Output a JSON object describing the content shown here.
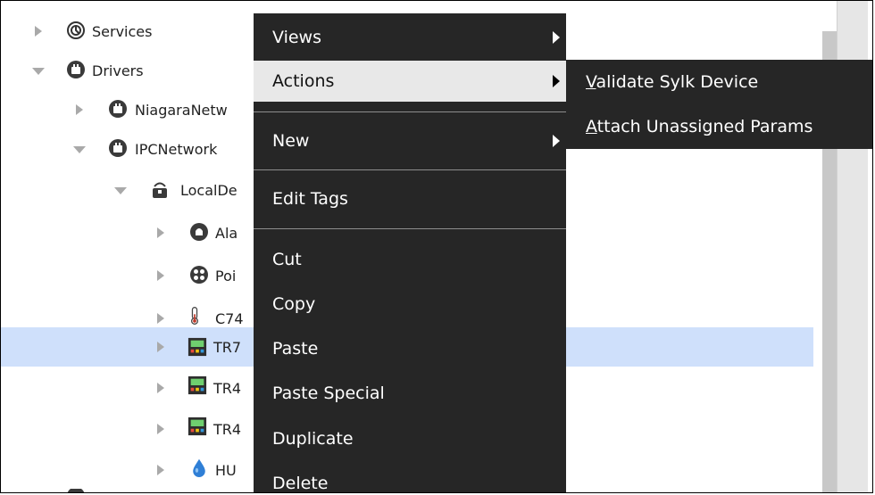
{
  "tree": {
    "items": [
      {
        "label": "Services",
        "icon": "services-gear-icon",
        "expanded": false
      },
      {
        "label": "Drivers",
        "icon": "drivers-icon",
        "expanded": true
      },
      {
        "label": "NiagaraNetw",
        "icon": "network-icon",
        "expanded": false
      },
      {
        "label": "IPCNetwork",
        "icon": "network-icon",
        "expanded": true
      },
      {
        "label": "LocalDe",
        "icon": "local-device-icon",
        "expanded": true
      },
      {
        "label": "Ala",
        "icon": "alarm-icon",
        "expanded": false
      },
      {
        "label": "Poi",
        "icon": "points-icon",
        "expanded": false
      },
      {
        "label": "C74",
        "icon": "thermometer-icon",
        "expanded": false
      },
      {
        "label": "TR7",
        "icon": "controller-icon",
        "expanded": false,
        "selected": true
      },
      {
        "label": "TR4",
        "icon": "controller-icon",
        "expanded": false
      },
      {
        "label": "TR4",
        "icon": "controller-icon",
        "expanded": false
      },
      {
        "label": "HU",
        "icon": "water-drop-icon",
        "expanded": false
      }
    ]
  },
  "context_menu": {
    "items": [
      {
        "label": "Views",
        "submenu": true
      },
      {
        "label": "Actions",
        "submenu": true,
        "highlighted": true
      },
      {
        "label": "New",
        "submenu": true
      },
      {
        "label": "Edit Tags"
      },
      {
        "label": "Cut"
      },
      {
        "label": "Copy"
      },
      {
        "label": "Paste"
      },
      {
        "label": "Paste Special"
      },
      {
        "label": "Duplicate"
      },
      {
        "label": "Delete"
      }
    ]
  },
  "actions_submenu": {
    "items": [
      {
        "label": "Validate Sylk Device",
        "mnemonic": "V",
        "rest": "alidate Sylk Device"
      },
      {
        "label": "Attach Unassigned Params",
        "mnemonic": "A",
        "rest": "ttach Unassigned Params"
      }
    ]
  },
  "colors": {
    "menu_bg": "#262626",
    "menu_highlight": "#e8e8e8",
    "selection": "#cfe0fb"
  }
}
